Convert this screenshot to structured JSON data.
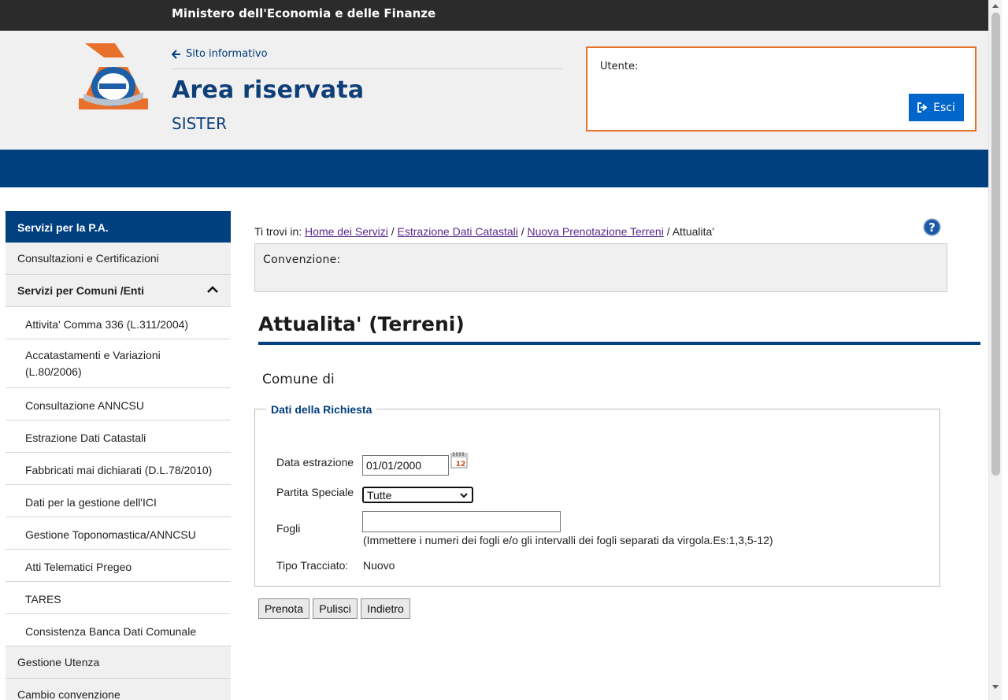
{
  "topbar": {
    "title": "Ministero dell'Economia e delle Finanze"
  },
  "header": {
    "back_link": "Sito informativo",
    "title": "Area riservata",
    "subtitle": "SISTER",
    "user_label": "Utente:",
    "logout_label": "Esci"
  },
  "colors": {
    "brand_blue": "#004080",
    "accent_orange": "#e8702a",
    "button_blue": "#0066cc"
  },
  "sidebar": {
    "heading": "Servizi per la P.A.",
    "items": [
      {
        "label": "Consultazioni e Certificazioni"
      },
      {
        "label": "Servizi per Comuni /Enti",
        "expanded": true
      },
      {
        "label": "Attivita' Comma 336 (L.311/2004)"
      },
      {
        "label": "Accatastamenti e Variazioni (L.80/2006)"
      },
      {
        "label": "Consultazione ANNCSU"
      },
      {
        "label": "Estrazione Dati Catastali"
      },
      {
        "label": "Fabbricati mai dichiarati (D.L.78/2010)"
      },
      {
        "label": "Dati per la gestione dell'ICI"
      },
      {
        "label": "Gestione Toponomastica/ANNCSU"
      },
      {
        "label": "Atti Telematici Pregeo"
      },
      {
        "label": "TARES"
      },
      {
        "label": "Consistenza Banca Dati Comunale"
      },
      {
        "label": "Gestione Utenza"
      },
      {
        "label": "Cambio convenzione"
      }
    ]
  },
  "breadcrumb": {
    "prefix": "Ti trovi in:",
    "links": [
      "Home dei Servizi",
      "Estrazione Dati Catastali",
      "Nuova Prenotazione Terreni"
    ],
    "separator": "/",
    "current": "Attualita'"
  },
  "convenzione_label": "Convenzione:",
  "page_title": "Attualita' (Terreni)",
  "comune_label": "Comune di",
  "form": {
    "legend": "Dati della Richiesta",
    "data_estrazione_label": "Data estrazione",
    "data_estrazione_value": "01/01/2000",
    "partita_label": "Partita Speciale",
    "partita_value": "Tutte",
    "fogli_label": "Fogli",
    "fogli_value": "",
    "fogli_hint": "(Immettere i numeri dei fogli e/o gli intervalli dei fogli separati da virgola.Es:1,3,5-12)",
    "tipo_label": "Tipo Tracciato:",
    "tipo_value": "Nuovo"
  },
  "buttons": {
    "prenota": "Prenota",
    "pulisci": "Pulisci",
    "indietro": "Indietro"
  },
  "icons": {
    "back": "arrow-left-icon",
    "logout": "sign-out-icon",
    "chevron": "chevron-up-icon",
    "help": "question-icon",
    "calendar": "calendar-icon",
    "logo": "agenzia-entrate-logo"
  }
}
